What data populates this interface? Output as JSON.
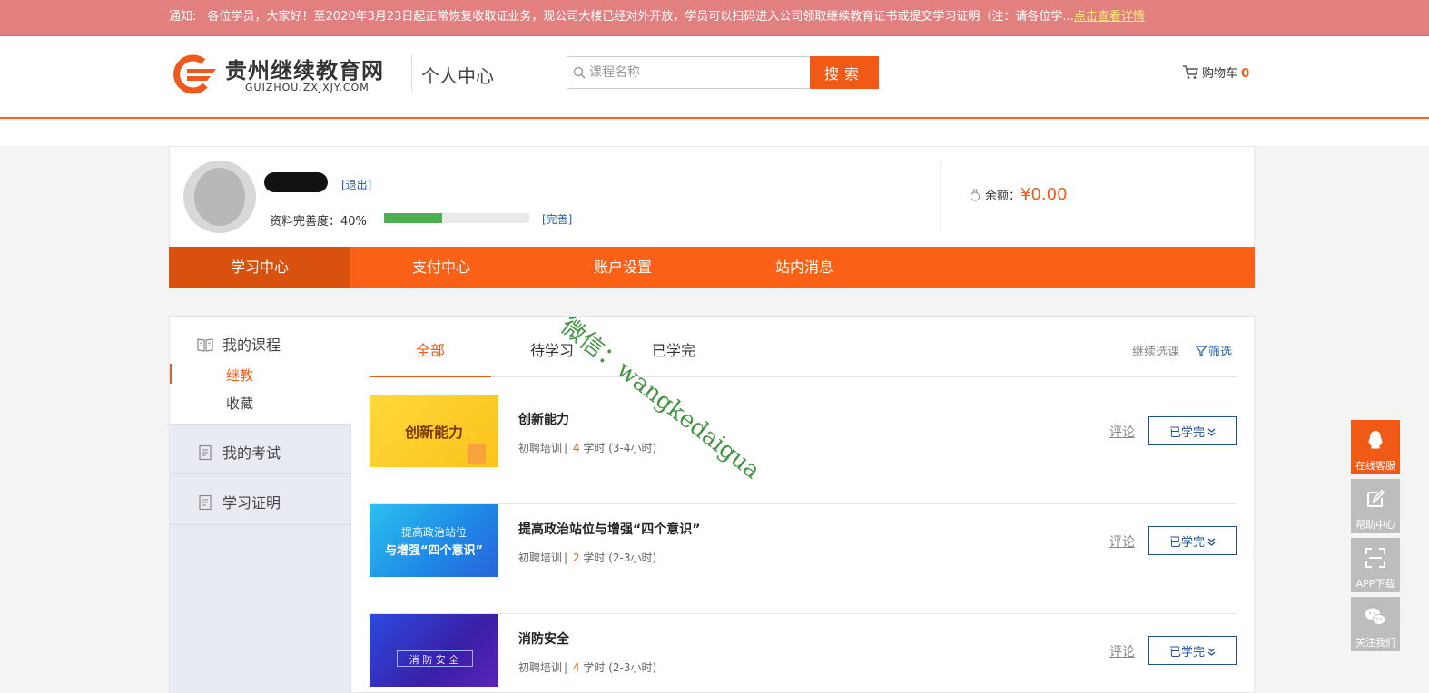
{
  "notice": {
    "label": "通知:",
    "text": "各位学员，大家好！至2020年3月23日起正常恢复收取证业务，现公司大楼已经对外开放，学员可以扫码进入公司领取继续教育证书或提交学习证明（注：请各位学...",
    "link": "点击查看详情"
  },
  "header": {
    "logo_name": "贵州继续教育网",
    "logo_sub": "GUIZHOU.ZXJXJY.COM",
    "title": "个人中心",
    "search_placeholder": "课程名称",
    "search_button": "搜索",
    "cart_label": "购物车",
    "cart_count": "0"
  },
  "profile": {
    "logout": "[退出]",
    "completeness_label": "资料完善度：40%",
    "completeness_value": 40,
    "improve": "[完善]",
    "balance_label": "余额：",
    "balance_amount": "¥0.00"
  },
  "mainnav": {
    "items": [
      {
        "label": "学习中心"
      },
      {
        "label": "支付中心"
      },
      {
        "label": "账户设置"
      },
      {
        "label": "站内消息"
      }
    ]
  },
  "sidebar": {
    "my_courses": "我的课程",
    "sub_items": [
      {
        "label": "继教"
      },
      {
        "label": "收藏"
      }
    ],
    "my_exams": "我的考试",
    "certificates": "学习证明"
  },
  "tabs": {
    "items": [
      {
        "label": "全部"
      },
      {
        "label": "待学习"
      },
      {
        "label": "已学完"
      }
    ],
    "continue": "继续选课",
    "filter": "筛选"
  },
  "courses": [
    {
      "thumb_title": "创新能力",
      "title": "创新能力",
      "category": "初聘培训",
      "hours": "4",
      "hours_unit": "学时",
      "duration": "(3-4小时)",
      "comment": "评论",
      "status": "已学完"
    },
    {
      "thumb_title": "提高政治站位",
      "thumb_title2": "与增强“四个意识”",
      "title": "提高政治站位与增强“四个意识”",
      "category": "初聘培训",
      "hours": "2",
      "hours_unit": "学时",
      "duration": "(2-3小时)",
      "comment": "评论",
      "status": "已学完"
    },
    {
      "thumb_title": "消 防 安 全",
      "title": "消防安全",
      "category": "初聘培训",
      "hours": "4",
      "hours_unit": "学时",
      "duration": "(2-3小时)",
      "comment": "评论",
      "status": "已学完"
    }
  ],
  "watermark": "微信：wangkedaigua",
  "float": [
    {
      "label": "在线客服",
      "icon": "qq-icon"
    },
    {
      "label": "帮助中心",
      "icon": "edit-icon"
    },
    {
      "label": "APP下载",
      "icon": "scan-icon"
    },
    {
      "label": "关注我们",
      "icon": "wechat-icon"
    }
  ],
  "colors": {
    "accent": "#f05a16",
    "nav": "#fa6116",
    "nav_active": "#d9510f",
    "link": "#1f5fb0",
    "notice_bg": "#e28080"
  }
}
